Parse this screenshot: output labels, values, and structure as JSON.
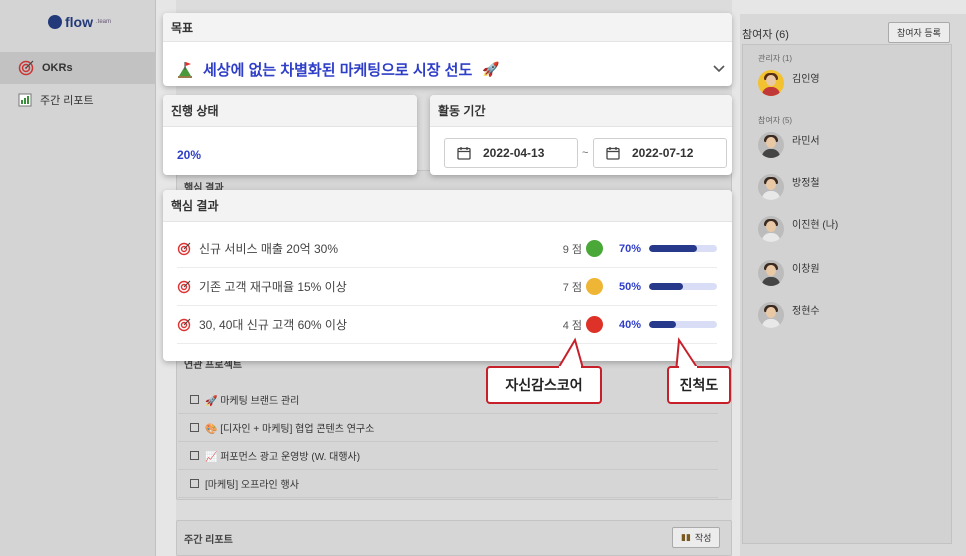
{
  "sidebar": {
    "logo": "flow",
    "logo_suffix": ".team",
    "items": [
      {
        "label": "OKRs",
        "icon": "target-icon",
        "active": true
      },
      {
        "label": "주간 리포트",
        "icon": "report-icon",
        "active": false
      }
    ]
  },
  "background": {
    "kr_label": "핵심 결과",
    "projects_label": "연관 프로젝트",
    "projects": [
      "🚀 마케팅 브랜드 관리",
      "🎨 [디자인 + 마케팅] 협업 콘텐츠 연구소",
      "📈 퍼포먼스 광고 운영방 (W. 대행사)",
      "[마케팅] 오프라인 행사"
    ],
    "weekly_report": "주간 리포트",
    "write_button": "작성"
  },
  "participants": {
    "title": "참여자 (6)",
    "register_button": "참여자 등록",
    "admin_label": "관리자 (1)",
    "member_label": "참여자 (5)",
    "admins": [
      "김인영"
    ],
    "members": [
      "라민서",
      "방정철",
      "이진현 (나)",
      "이창원",
      "정현수"
    ]
  },
  "goal": {
    "header": "목표",
    "flag_icon": "flag-icon",
    "text": "세상에 없는 차별화된 마케팅으로 시장 선도",
    "emoji": "🚀"
  },
  "progress": {
    "header": "진행 상태",
    "percent_label": "20%",
    "value": 0.2
  },
  "period": {
    "header": "활동 기간",
    "start": "2022-04-13",
    "separator": "~",
    "end": "2022-07-12"
  },
  "key_results": {
    "header": "핵심 결과",
    "rows": [
      {
        "name": "신규 서비스 매출 20억 30%",
        "score": "9 점",
        "color": "#49a838",
        "pct": "70%",
        "value": 0.7
      },
      {
        "name": "기존 고객 재구매율 15% 이상",
        "score": "7 점",
        "color": "#efb534",
        "pct": "50%",
        "value": 0.5
      },
      {
        "name": "30, 40대 신규 고객 60% 이상",
        "score": "4 점",
        "color": "#de3127",
        "pct": "40%",
        "value": 0.4
      }
    ]
  },
  "callouts": {
    "confidence": "자신감스코어",
    "progress": "진척도"
  },
  "colors": {
    "accent": "#2f3ec8",
    "bar": "#3c52c8",
    "callout_border": "#c8202a"
  }
}
